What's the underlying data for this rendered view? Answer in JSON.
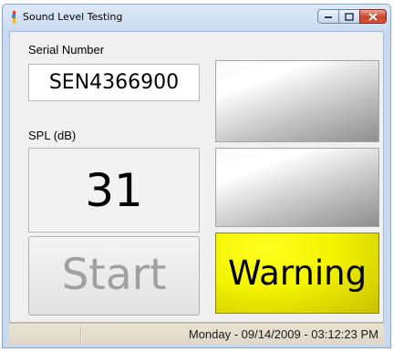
{
  "window": {
    "title": "Sound Level Testing",
    "controls": {
      "minimize_icon": "minimize-icon",
      "maximize_icon": "maximize-icon",
      "close_icon": "close-icon"
    }
  },
  "serial": {
    "label": "Serial Number",
    "value": "SEN4366900"
  },
  "spl": {
    "label": "SPL (dB)",
    "value": "31"
  },
  "start_button": {
    "label": "Start"
  },
  "indicators": [
    {
      "name": "top-light",
      "state": "off"
    },
    {
      "name": "middle-light",
      "state": "off"
    },
    {
      "name": "warning-light",
      "label": "Warning",
      "state": "on",
      "color": "#f2f200"
    }
  ],
  "status": {
    "datetime": "Monday - 09/14/2009 - 03:12:23 PM"
  }
}
